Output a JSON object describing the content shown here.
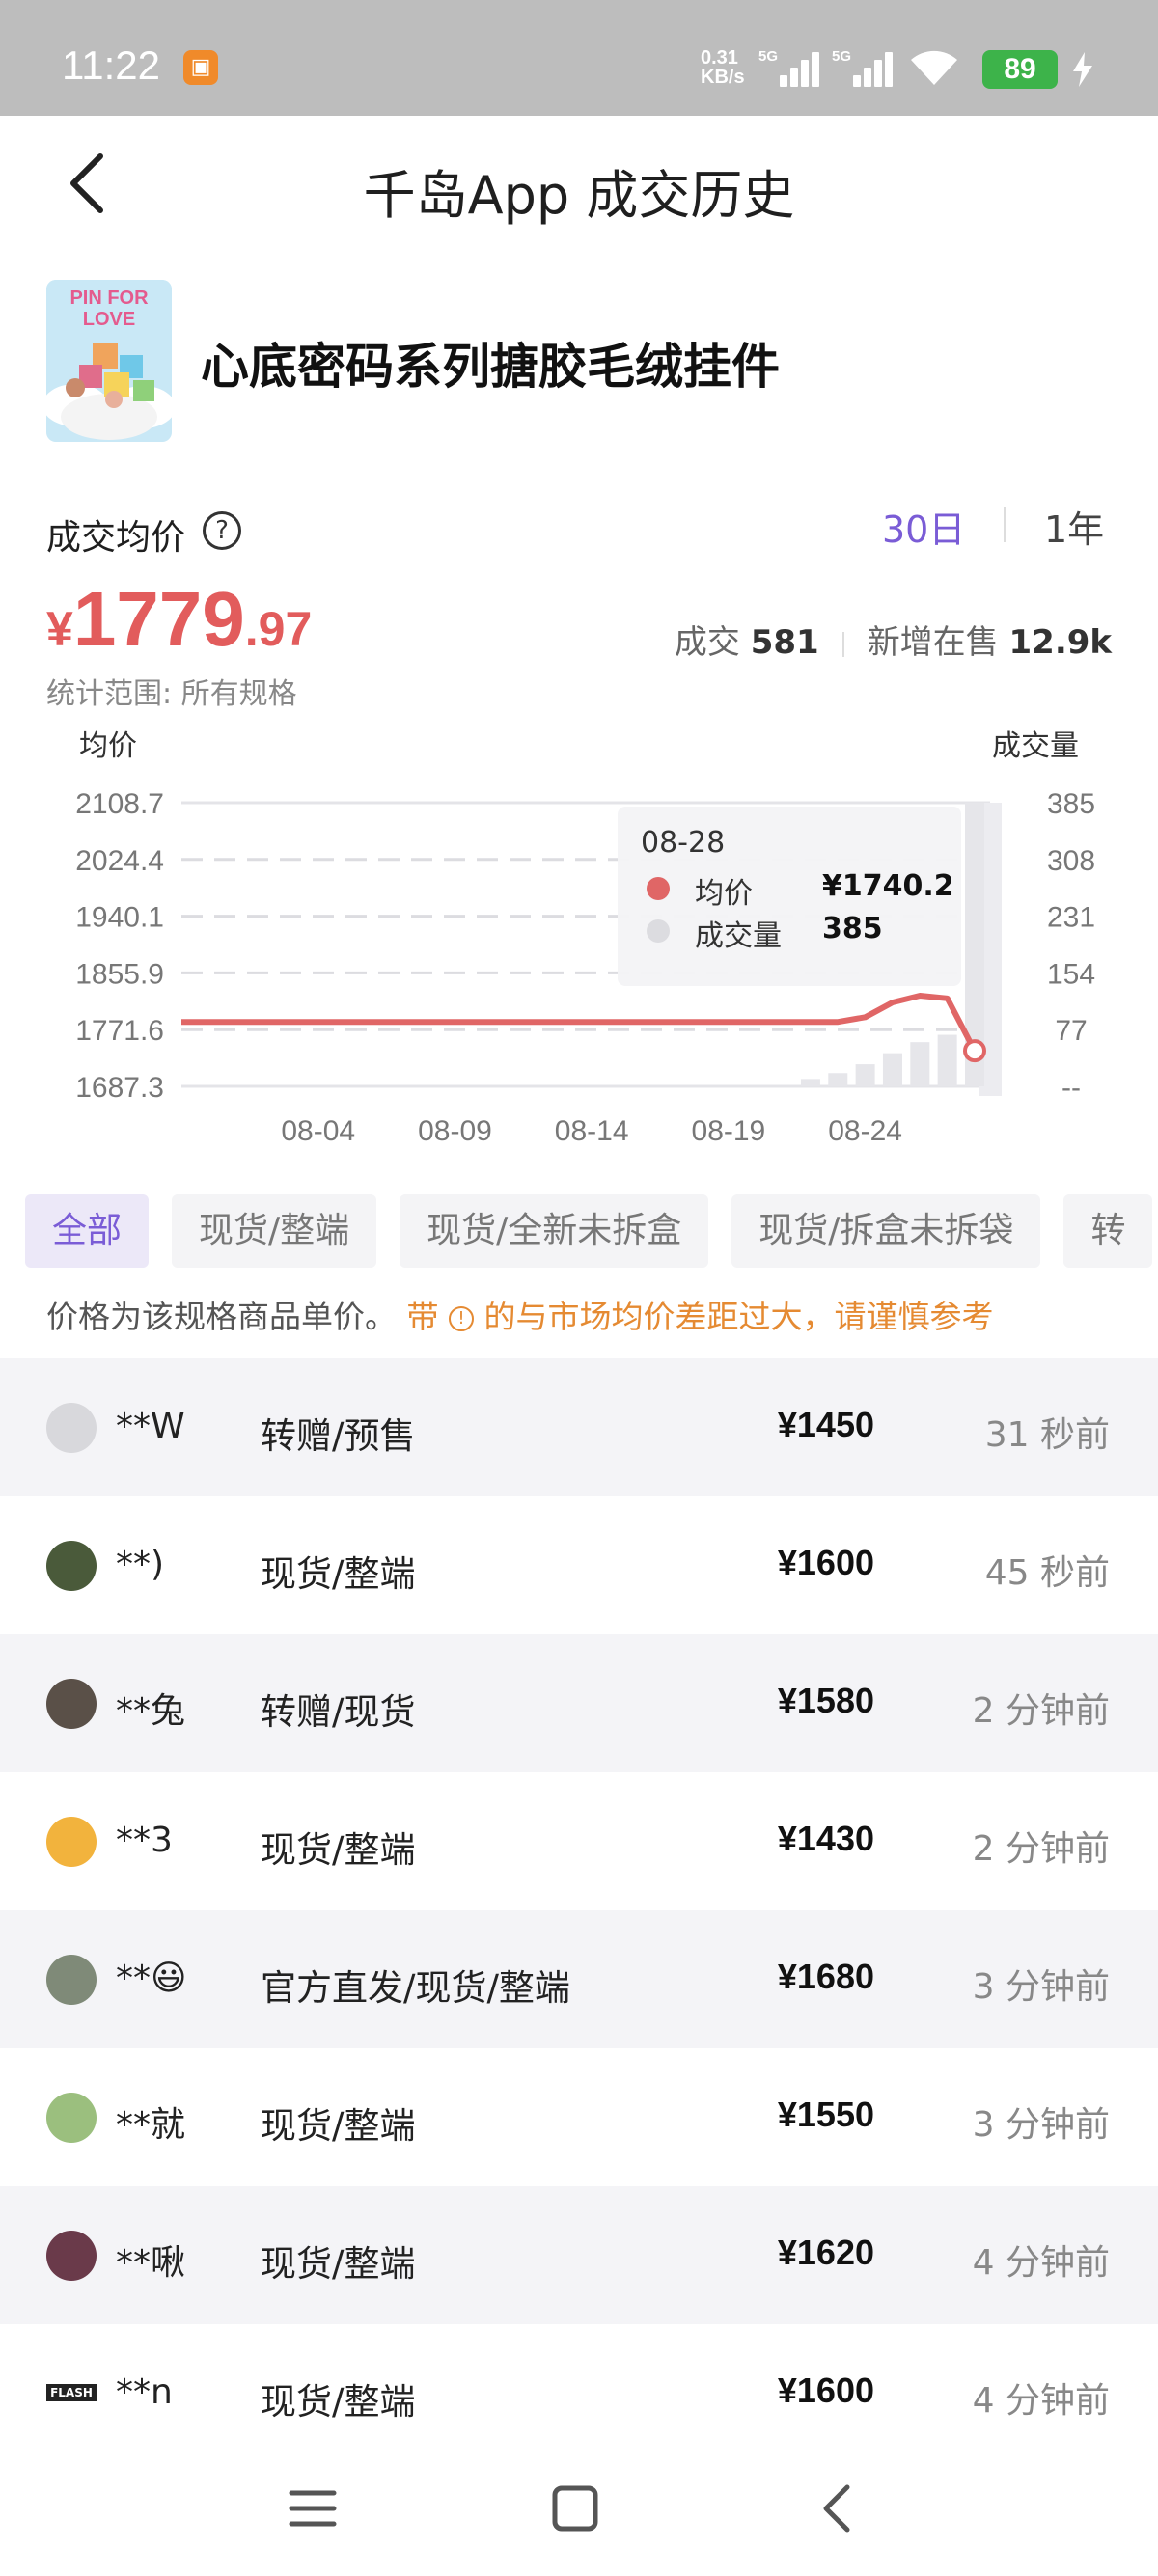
{
  "status_bar": {
    "time": "11:22",
    "net_speed_value": "0.31",
    "net_speed_unit": "KB/s",
    "sim1_label": "5G",
    "sim2_label": "5G",
    "battery": "89"
  },
  "header": {
    "title": "千岛App 成交历史"
  },
  "product": {
    "name": "心底密码系列搪胶毛绒挂件",
    "thumb_text": "PIN FOR LOVE"
  },
  "price_section": {
    "label": "成交均价",
    "help_glyph": "?",
    "currency": "¥",
    "price_int": "1779",
    "price_dec": ".97",
    "range_tabs": [
      "30日",
      "1年"
    ],
    "active_range": "30日",
    "deals_label": "成交",
    "deals_value": "581",
    "new_listing_label": "新增在售",
    "new_listing_value": "12.9k",
    "scope_note": "统计范围: 所有规格",
    "accent_color": "#7a5cd6",
    "price_color": "#e25c5c"
  },
  "chart_data": {
    "type": "line",
    "ylabel_left": "均价",
    "ylabel_right": "成交量",
    "y_ticks_left": [
      "2108.7",
      "2024.4",
      "1940.1",
      "1855.9",
      "1771.6",
      "1687.3"
    ],
    "y_ticks_right": [
      "385",
      "308",
      "231",
      "154",
      "77",
      "--"
    ],
    "ylim": [
      1687.3,
      2108.7
    ],
    "ylim_right": [
      0,
      385
    ],
    "x_tick_labels": [
      "08-04",
      "08-09",
      "08-14",
      "08-19",
      "08-24"
    ],
    "x": [
      "07-30",
      "07-31",
      "08-01",
      "08-02",
      "08-03",
      "08-04",
      "08-05",
      "08-06",
      "08-07",
      "08-08",
      "08-09",
      "08-10",
      "08-11",
      "08-12",
      "08-13",
      "08-14",
      "08-15",
      "08-16",
      "08-17",
      "08-18",
      "08-19",
      "08-20",
      "08-21",
      "08-22",
      "08-23",
      "08-24",
      "08-25",
      "08-26",
      "08-27",
      "08-28"
    ],
    "series": [
      {
        "name": "均价",
        "color": "#e06666",
        "values": [
          1783,
          1783,
          1783,
          1783,
          1783,
          1783,
          1783,
          1783,
          1783,
          1783,
          1783,
          1783,
          1783,
          1783,
          1783,
          1783,
          1783,
          1783,
          1783,
          1783,
          1783,
          1783,
          1783,
          1783,
          1783,
          1790,
          1812,
          1822,
          1818,
          1740.2
        ]
      },
      {
        "name": "成交量",
        "color": "#e6e6ea",
        "values": [
          0,
          0,
          0,
          0,
          0,
          0,
          0,
          0,
          0,
          0,
          0,
          0,
          0,
          0,
          0,
          0,
          0,
          0,
          0,
          0,
          0,
          0,
          0,
          10,
          18,
          30,
          45,
          60,
          70,
          385
        ]
      }
    ],
    "tooltip": {
      "date": "08-28",
      "avg_label": "均价",
      "avg_value": "¥1740.2",
      "volume_label": "成交量",
      "volume_value": "385"
    },
    "grid": true
  },
  "filters": {
    "chips": [
      "全部",
      "现货/整端",
      "现货/全新未拆盒",
      "现货/拆盒未拆袋",
      "转"
    ],
    "active": "全部"
  },
  "price_note": {
    "text": "价格为该规格商品单价。",
    "warning_prefix": "带",
    "warning_icon": "!",
    "warning_text": "的与市场均价差距过大，请谨慎参考"
  },
  "transactions": [
    {
      "user": "**W",
      "type": "转赠/预售",
      "price": "¥1450",
      "time": "31 秒前",
      "avatar_color": "#d8d8dc"
    },
    {
      "user": "**)",
      "type": "现货/整端",
      "price": "¥1600",
      "time": "45 秒前",
      "avatar_color": "#4a5a3a"
    },
    {
      "user": "**兔",
      "type": "转赠/现货",
      "price": "¥1580",
      "time": "2 分钟前",
      "avatar_color": "#5a5048"
    },
    {
      "user": "**3",
      "type": "现货/整端",
      "price": "¥1430",
      "time": "2 分钟前",
      "avatar_color": "#f2b33d"
    },
    {
      "user": "**😃",
      "type": "官方直发/现货/整端",
      "price": "¥1680",
      "time": "3 分钟前",
      "avatar_color": "#7f8a78"
    },
    {
      "user": "**就",
      "type": "现货/整端",
      "price": "¥1550",
      "time": "3 分钟前",
      "avatar_color": "#9bbf7e"
    },
    {
      "user": "**啾",
      "type": "现货/整端",
      "price": "¥1620",
      "time": "4 分钟前",
      "avatar_color": "#6a3a4a"
    },
    {
      "user": "**n",
      "type": "现货/整端",
      "price": "¥1600",
      "time": "4 分钟前",
      "avatar_color": "#222222",
      "avatar_text": "FLASH"
    }
  ]
}
